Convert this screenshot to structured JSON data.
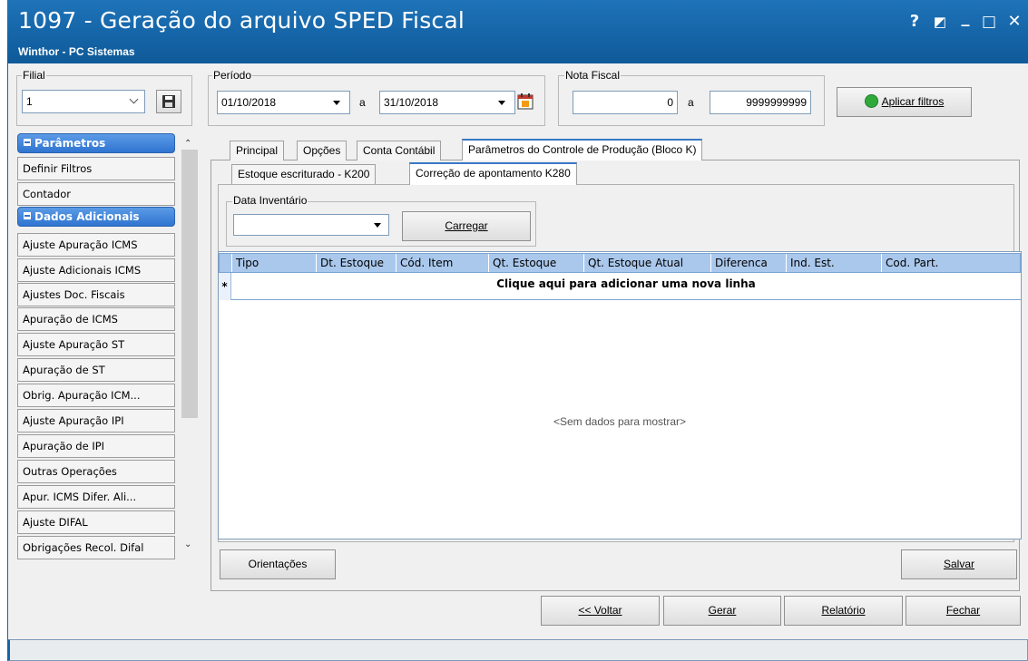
{
  "window": {
    "title": "1097 - Geração do arquivo SPED Fiscal",
    "subtitle": "Winthor - PC Sistemas",
    "controls": {
      "help": "?",
      "restore": "◩",
      "minimize": "_",
      "maximize": "□",
      "close": "✕"
    }
  },
  "filters": {
    "filial": {
      "label": "Filial",
      "value": "1"
    },
    "periodo": {
      "label": "Período",
      "from": "01/10/2018",
      "separator": "a",
      "to": "31/10/2018"
    },
    "nota_fiscal": {
      "label": "Nota Fiscal",
      "from": "0",
      "separator": "a",
      "to": "9999999999"
    },
    "apply_label": "Aplicar filtros"
  },
  "sidebar": {
    "groups": [
      {
        "title": "Parâmetros",
        "items": [
          "Definir Filtros",
          "Contador"
        ]
      },
      {
        "title": "Dados Adicionais",
        "items": [
          "Ajuste Apuração ICMS",
          "Ajuste Adicionais ICMS",
          "Ajustes Doc. Fiscais",
          "Apuração de ICMS",
          "Ajuste Apuração ST",
          "Apuração de ST",
          "Obrig. Apuração ICM...",
          "Ajuste Apuração IPI",
          "Apuração de IPI",
          "Outras Operações",
          "Apur. ICMS Difer. Ali...",
          "Ajuste DIFAL",
          "Obrigações Recol. Difal"
        ]
      }
    ]
  },
  "tabs": [
    "Principal",
    "Opções",
    "Conta Contábil",
    "Parâmetros do Controle de Produção (Bloco K)"
  ],
  "subtabs": [
    "Estoque escriturado - K200",
    "Correção de apontamento K280"
  ],
  "inventory": {
    "label": "Data Inventário",
    "value": "",
    "load_label": "Carregar"
  },
  "grid": {
    "columns": [
      "Tipo",
      "Dt. Estoque",
      "Cód. Item",
      "Qt. Estoque",
      "Qt. Estoque Atual",
      "Diferenca",
      "Ind. Est.",
      "Cod. Part."
    ],
    "new_row_marker": "*",
    "new_row_text": "Clique aqui para adicionar uma nova linha",
    "empty_text": "<Sem dados para mostrar>"
  },
  "buttons": {
    "orientacoes": "Orientações",
    "salvar": "Salvar",
    "voltar": "<< Voltar",
    "gerar": "Gerar",
    "relatorio": "Relatório",
    "fechar": "Fechar"
  },
  "colors": {
    "titlebar": "#1565a8",
    "accent": "#2f74d0",
    "grid_header": "#aac8ec"
  }
}
